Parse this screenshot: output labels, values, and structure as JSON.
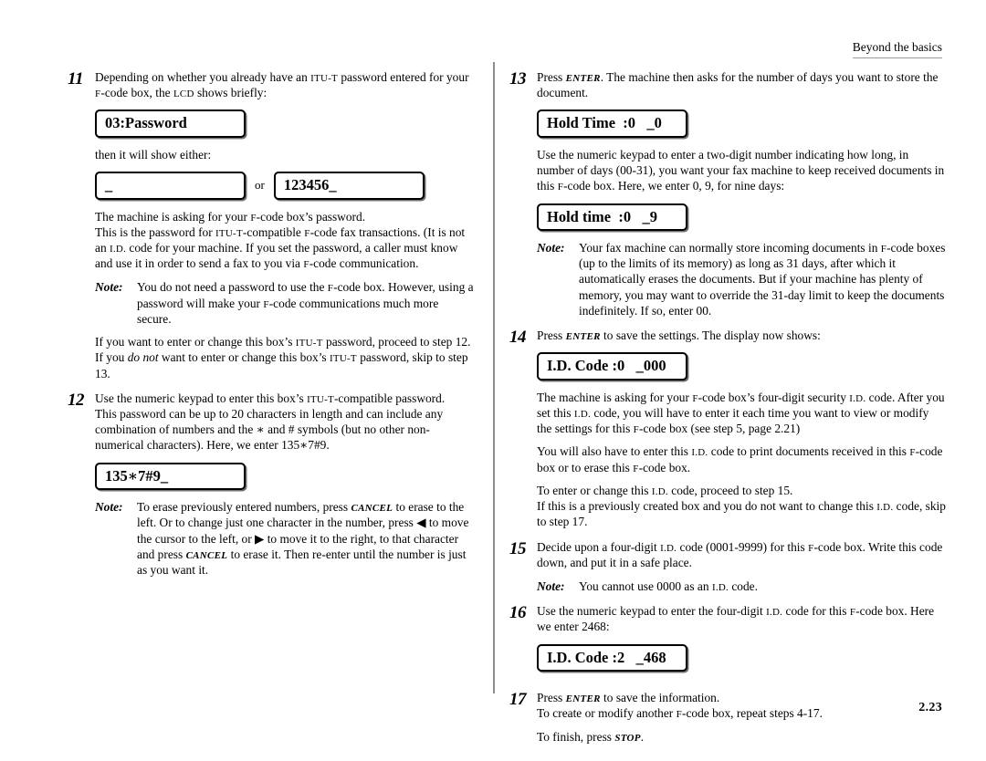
{
  "header": {
    "running_head": "Beyond the basics"
  },
  "folio": {
    "page_number": "2.23"
  },
  "left_column": {
    "step11": {
      "number": "11",
      "intro_a": "Depending on whether you already have an ",
      "intro_itut": "ITU-T",
      "intro_b": " password entered for your ",
      "intro_fcode": "F",
      "intro_c": "-code box, the ",
      "intro_lcd": "LCD",
      "intro_d": " shows briefly:",
      "lcd_password": "03:Password",
      "then_text": "then it will show either:",
      "lcd_empty": "_",
      "or_label": "or",
      "lcd_123456": "123456_",
      "p1_a": "The machine is asking for your ",
      "p1_fcode": "F",
      "p1_b": "-code box’s password.",
      "p2_a": "This is the password for ",
      "p2_itut": "ITU-T",
      "p2_b": "-compatible ",
      "p2_fcode": "F",
      "p2_c": "-code fax transactions. (It is not an ",
      "p2_id": "I.D.",
      "p2_d": " code for your machine. If you set the password, a caller must know and use it in order to send a fax to you via ",
      "p2_fcode2": "F",
      "p2_e": "-code communication.",
      "note_label": "Note:",
      "note_a": "You do not need a password to use the ",
      "note_fcode": "F",
      "note_b": "-code box. However, using a password will make your ",
      "note_fcode2": "F",
      "note_c": "-code communications much more secure.",
      "p3_a": "If you want to enter or change this box’s ",
      "p3_itut": "ITU-T",
      "p3_b": " password, proceed to step 12.",
      "p4_a": "If you ",
      "p4_donot": "do not",
      "p4_b": " want to enter or change this box’s ",
      "p4_itut": "ITU-T",
      "p4_c": " password, skip to step 13."
    },
    "step12": {
      "number": "12",
      "p1_a": "Use the numeric keypad to enter this box’s ",
      "p1_itut": "ITU-T",
      "p1_b": "-compatible password.",
      "p2": "This password can be up to 20 characters in length and can include any combination of numbers and the ∗ and # symbols (but no other non-numerical characters). Here, we enter 135∗7#9.",
      "lcd_value": "135∗7#9_",
      "note_label": "Note:",
      "note_a": "To erase previously entered numbers, press ",
      "note_cancel1": "CANCEL",
      "note_b": " to erase to the left. Or to change just one character in the number, press ",
      "note_left_arrow": "◀",
      "note_c": " to move the cursor to the left, or ",
      "note_right_arrow": "▶",
      "note_d": " to move it to the right, to that character and press ",
      "note_cancel2": "CANCEL",
      "note_e": " to erase it. Then re-enter until the number is just as you want it."
    }
  },
  "right_column": {
    "step13": {
      "number": "13",
      "p1_a": "Press ",
      "p1_enter": "ENTER",
      "p1_b": ". The machine then asks for the number of days you want to store the document.",
      "lcd_hold_time": "Hold Time  :0   _0",
      "p2_a": "Use the numeric keypad to enter a two-digit number indicating how long, in number of days (00-31), you want your fax machine to keep received documents in this ",
      "p2_fcode": "F",
      "p2_b": "-code box. Here, we enter 0, 9, for nine days:",
      "lcd_hold_time_9": "Hold time  :0   _9",
      "note_label": "Note:",
      "note_a": "Your fax machine can normally store incoming documents in ",
      "note_fcode": "F",
      "note_b": "-code boxes (up to the limits of its memory) as long as 31 days, after which it automatically erases the documents. But if your machine has plenty of memory, you may want to override the 31-day limit to keep the documents indefinitely. If so, enter 00."
    },
    "step14": {
      "number": "14",
      "p1_a": "Press ",
      "p1_enter": "ENTER",
      "p1_b": " to save the settings. The display now shows:",
      "lcd_id_code": "I.D. Code :0   _000",
      "p2_a": "The machine is asking for your ",
      "p2_fcode": "F",
      "p2_b": "-code box’s four-digit security ",
      "p2_id": "I.D.",
      "p2_c": " code. After you set this ",
      "p2_id2": "I.D.",
      "p2_d": " code, you will have to enter it each time you want to view or modify the settings for this ",
      "p2_fcode2": "F",
      "p2_e": "-code box (see step 5, page 2.21)",
      "p3_a": "You will also have to enter this ",
      "p3_id": "I.D.",
      "p3_b": " code to print documents received in this ",
      "p3_fcode": "F",
      "p3_c": "-code box or to erase this ",
      "p3_fcode2": "F",
      "p3_d": "-code box.",
      "p4_a": "To enter or change this ",
      "p4_id": "I.D.",
      "p4_b": " code, proceed to step 15.",
      "p5_a": "If this is a previously created box and you do not want to change this ",
      "p5_id": "I.D.",
      "p5_b": " code, skip to step 17."
    },
    "step15": {
      "number": "15",
      "p1_a": "Decide upon a four-digit ",
      "p1_id": "I.D.",
      "p1_b": " code (0001-9999) for this ",
      "p1_fcode": "F",
      "p1_c": "-code box. Write this code down, and put it in a safe place.",
      "note_label": "Note:",
      "note_a": "You cannot use 0000 as an ",
      "note_id": "I.D.",
      "note_b": " code."
    },
    "step16": {
      "number": "16",
      "p1_a": "Use the numeric keypad to enter the four-digit ",
      "p1_id": "I.D.",
      "p1_b": " code for this ",
      "p1_fcode": "F",
      "p1_c": "-code box. Here we enter 2468:",
      "lcd_id_code": "I.D. Code :2   _468"
    },
    "step17": {
      "number": "17",
      "p1_a": "Press ",
      "p1_enter": "ENTER",
      "p1_b": " to save the information.",
      "p2_a": "To create or modify another ",
      "p2_fcode": "F",
      "p2_b": "-code box, repeat steps 4-17.",
      "p3_a": "To finish, press ",
      "p3_stop": "STOP",
      "p3_b": "."
    }
  }
}
